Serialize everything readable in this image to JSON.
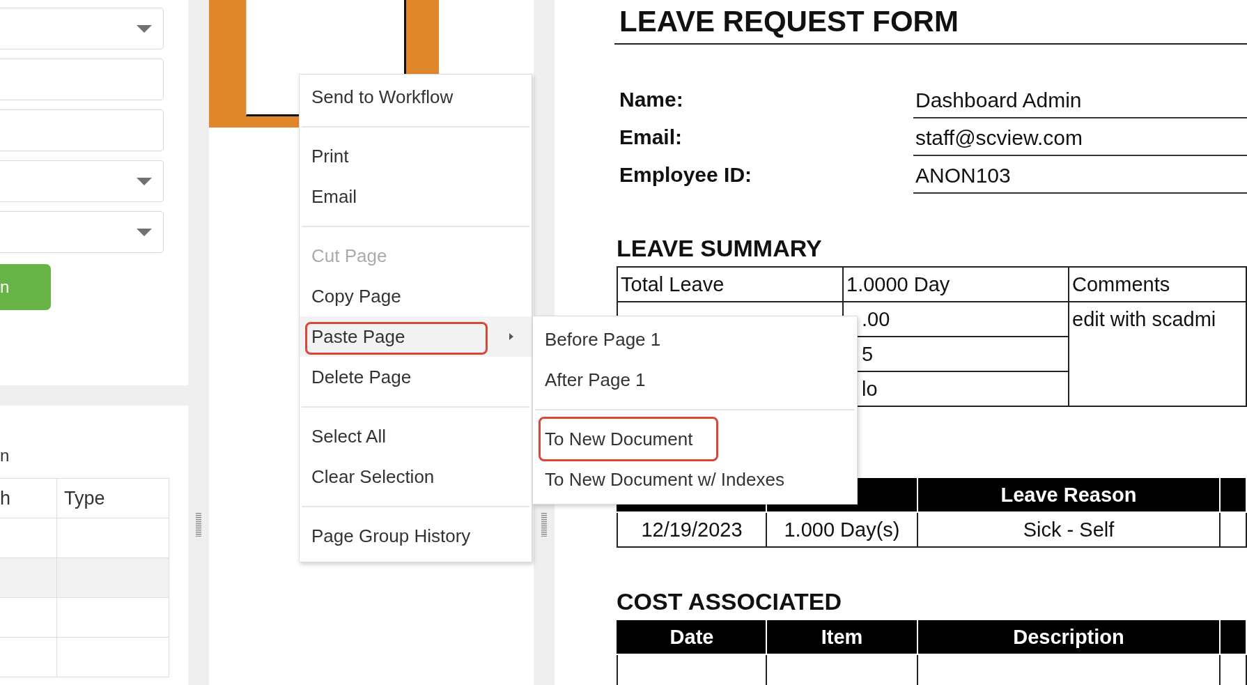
{
  "filter_panel": {
    "fields": [
      {
        "kind": "dropdown"
      },
      {
        "kind": "text"
      },
      {
        "kind": "text"
      },
      {
        "kind": "dropdown"
      },
      {
        "kind": "dropdown"
      }
    ],
    "search_button": {
      "label": "n"
    }
  },
  "results": {
    "caption": "n",
    "columns": [
      "h",
      "Type"
    ],
    "rows": [
      {
        "kind": "plain"
      },
      {
        "kind": "striped"
      },
      {
        "kind": "plain"
      },
      {
        "kind": "plain"
      }
    ]
  },
  "thumbnails": [
    {
      "selected": true
    }
  ],
  "menu": {
    "items": [
      {
        "kind": "item",
        "label": "Send to Workflow",
        "disabled": false,
        "selected": false,
        "submenu": false,
        "outlined": false
      },
      {
        "kind": "separator"
      },
      {
        "kind": "item",
        "label": "Print",
        "disabled": false,
        "selected": false,
        "submenu": false,
        "outlined": false
      },
      {
        "kind": "item",
        "label": "Email",
        "disabled": false,
        "selected": false,
        "submenu": false,
        "outlined": false
      },
      {
        "kind": "separator"
      },
      {
        "kind": "item",
        "label": "Cut Page",
        "disabled": true,
        "selected": false,
        "submenu": false,
        "outlined": false
      },
      {
        "kind": "item",
        "label": "Copy Page",
        "disabled": false,
        "selected": false,
        "submenu": false,
        "outlined": false
      },
      {
        "kind": "item",
        "label": "Paste Page",
        "disabled": false,
        "selected": true,
        "submenu": true,
        "outlined": true
      },
      {
        "kind": "item",
        "label": "Delete Page",
        "disabled": false,
        "selected": false,
        "submenu": false,
        "outlined": false
      },
      {
        "kind": "separator"
      },
      {
        "kind": "item",
        "label": "Select All",
        "disabled": false,
        "selected": false,
        "submenu": false,
        "outlined": false
      },
      {
        "kind": "item",
        "label": "Clear Selection",
        "disabled": false,
        "selected": false,
        "submenu": false,
        "outlined": false
      },
      {
        "kind": "separator"
      },
      {
        "kind": "item",
        "label": "Page Group History",
        "disabled": false,
        "selected": false,
        "submenu": false,
        "outlined": false
      }
    ]
  },
  "submenu": {
    "items": [
      {
        "kind": "item",
        "label": "Before Page 1",
        "disabled": false,
        "selected": false,
        "submenu": false,
        "outlined": false
      },
      {
        "kind": "item",
        "label": "After Page 1",
        "disabled": false,
        "selected": false,
        "submenu": false,
        "outlined": false
      },
      {
        "kind": "separator"
      },
      {
        "kind": "item",
        "label": "To New Document",
        "disabled": false,
        "selected": false,
        "submenu": false,
        "outlined": true
      },
      {
        "kind": "item",
        "label": "To New Document w/ Indexes",
        "disabled": false,
        "selected": false,
        "submenu": false,
        "outlined": false
      }
    ]
  },
  "document": {
    "title": "LEAVE REQUEST FORM",
    "fields": [
      {
        "label": "Name:",
        "value": "Dashboard Admin"
      },
      {
        "label": "Email:",
        "value": "staff@scview.com"
      },
      {
        "label": "Employee ID:",
        "value": "ANON103"
      }
    ],
    "leave_summary": {
      "heading": "LEAVE SUMMARY",
      "comments_label": "Comments",
      "comments": "edit with scadmi",
      "rows": [
        {
          "label": "Total Leave",
          "value": "1.0000 Day",
          "partly_hidden": false
        },
        {
          "value": ".00",
          "partly_hidden": true
        },
        {
          "value": "5",
          "partly_hidden": true
        },
        {
          "value": "lo",
          "partly_hidden": true
        }
      ]
    },
    "leave_details": {
      "columns": [
        {
          "kind": "covered"
        },
        {
          "kind": "covered"
        },
        {
          "kind": "text",
          "label": "Leave Reason"
        },
        {
          "kind": "cut"
        }
      ],
      "rows": [
        [
          "12/19/2023",
          "1.000 Day(s)",
          "Sick - Self"
        ]
      ]
    },
    "cost_associated": {
      "heading": "COST ASSOCIATED",
      "columns": [
        {
          "kind": "text",
          "label": "Date"
        },
        {
          "kind": "text",
          "label": "Item"
        },
        {
          "kind": "text",
          "label": "Description"
        },
        {
          "kind": "cut"
        }
      ]
    }
  }
}
